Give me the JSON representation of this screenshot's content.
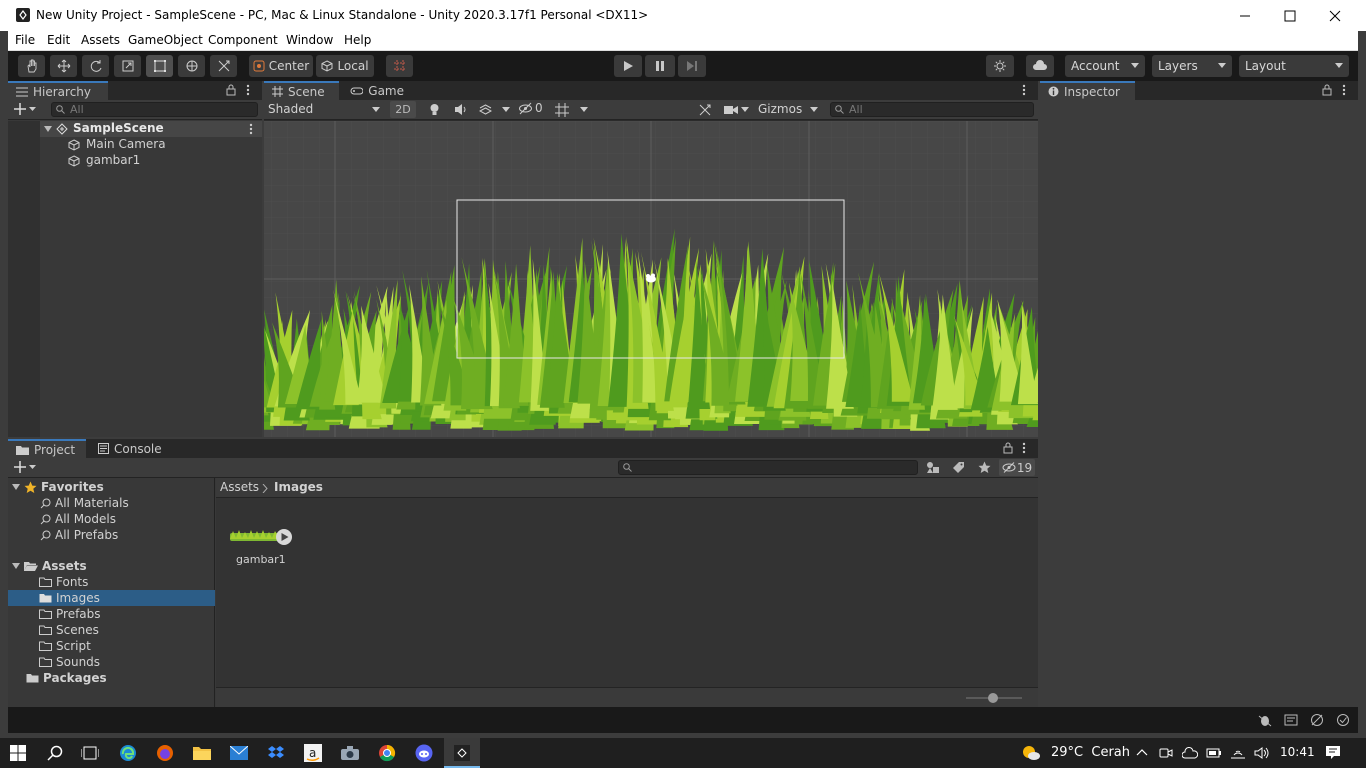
{
  "window": {
    "title": "New Unity Project - SampleScene - PC, Mac & Linux Standalone - Unity 2020.3.17f1 Personal <DX11>"
  },
  "menu": [
    "File",
    "Edit",
    "Assets",
    "GameObject",
    "Component",
    "Window",
    "Help"
  ],
  "toolbar": {
    "pivot_mode": "Center",
    "pivot_space": "Local",
    "account": "Account",
    "layers": "Layers",
    "layout": "Layout"
  },
  "hierarchy": {
    "tab": "Hierarchy",
    "search_placeholder": "All",
    "scene": "SampleScene",
    "objects": [
      "Main Camera",
      "gambar1"
    ]
  },
  "scene_panel": {
    "tabs": [
      "Scene",
      "Game"
    ],
    "shading": "Shaded",
    "mode_2d": "2D",
    "hidden_count": "0",
    "gizmos": "Gizmos",
    "search_placeholder": "All"
  },
  "inspector": {
    "tab": "Inspector"
  },
  "project": {
    "tabs": [
      "Project",
      "Console"
    ],
    "hidden_count": "19",
    "breadcrumb": [
      "Assets",
      "Images"
    ],
    "favorites_label": "Favorites",
    "favorites": [
      "All Materials",
      "All Models",
      "All Prefabs"
    ],
    "assets_label": "Assets",
    "asset_folders": [
      "Fonts",
      "Images",
      "Prefabs",
      "Scenes",
      "Script",
      "Sounds"
    ],
    "packages_label": "Packages",
    "selected_folder": "Images",
    "items": [
      {
        "name": "gambar1"
      }
    ]
  },
  "taskbar": {
    "weather": "29°C  Cerah",
    "time": "10:41"
  },
  "colors": {
    "accent": "#3a79bb",
    "selection": "#2c5d87",
    "grass_light": "#a6d02f",
    "grass_dark": "#4f9b1e"
  }
}
